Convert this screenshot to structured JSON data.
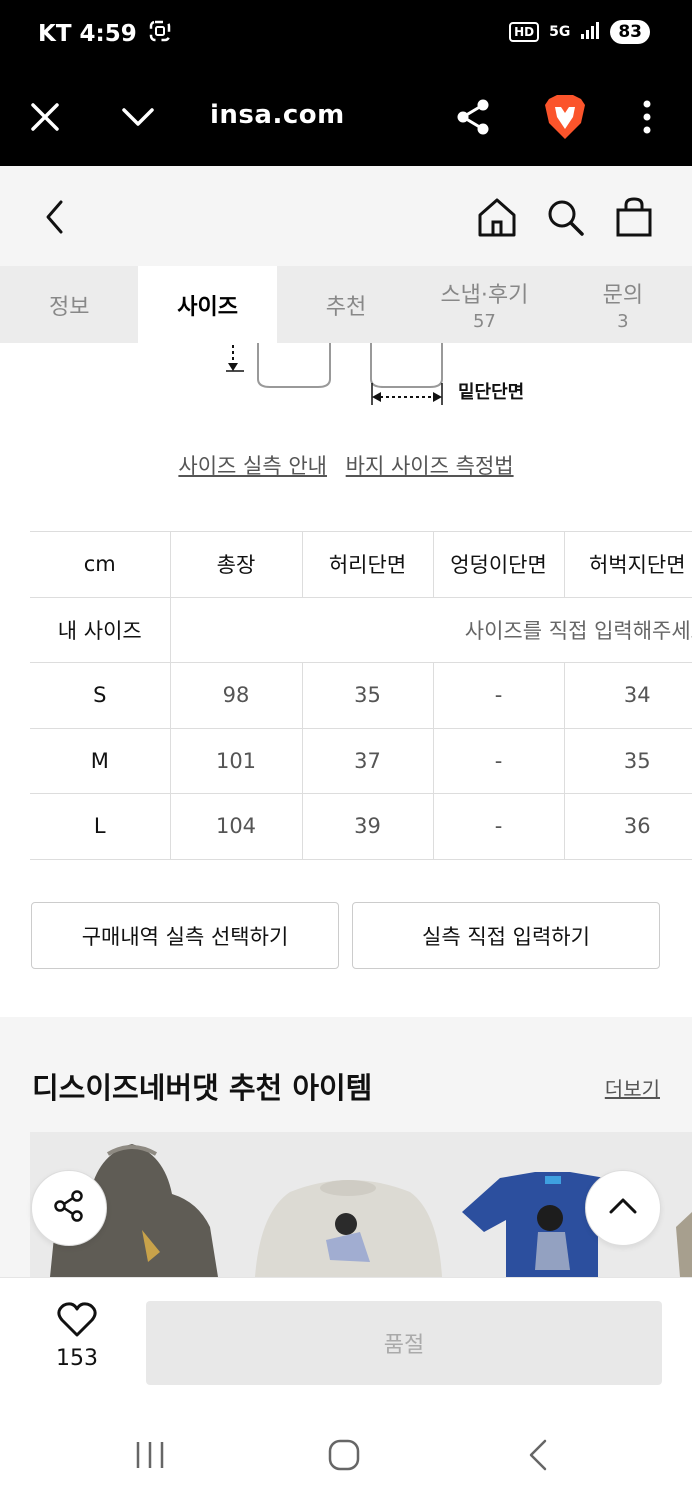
{
  "status_bar": {
    "carrier_time": "KT 4:59",
    "hd": "HD",
    "network": "5G",
    "battery": "83"
  },
  "browser": {
    "url": "insa.com",
    "icons": [
      "close-icon",
      "chevron-down-icon",
      "share-icon",
      "brave-lion-icon",
      "more-vertical-icon"
    ],
    "brand_color": "#fb542b"
  },
  "header": {
    "icons": [
      "back-icon",
      "home-icon",
      "search-icon",
      "shopping-bag-icon"
    ]
  },
  "tabs": [
    {
      "label": "정보",
      "count": ""
    },
    {
      "label": "사이즈",
      "count": ""
    },
    {
      "label": "추천",
      "count": ""
    },
    {
      "label": "스냅·후기",
      "count": "57"
    },
    {
      "label": "문의",
      "count": "3"
    }
  ],
  "diagram": {
    "label": "밑단단면"
  },
  "links": {
    "guide": "사이즈 실측 안내",
    "measure": "바지 사이즈 측정법"
  },
  "size_table": {
    "headers": [
      "cm",
      "총장",
      "허리단면",
      "엉덩이단면",
      "허벅지단면"
    ],
    "my_size": {
      "label": "내 사이즈",
      "placeholder": "사이즈를 직접 입력해주세요"
    },
    "rows": [
      {
        "size": "S",
        "values": [
          "98",
          "35",
          "-",
          "34"
        ]
      },
      {
        "size": "M",
        "values": [
          "101",
          "37",
          "-",
          "35"
        ]
      },
      {
        "size": "L",
        "values": [
          "104",
          "39",
          "-",
          "36"
        ]
      }
    ]
  },
  "buttons": {
    "purchase_history": "구매내역 실측 선택하기",
    "direct_input": "실측 직접 입력하기"
  },
  "recommend": {
    "title": "디스이즈네버댓 추천 아이템",
    "more": "더보기"
  },
  "buy_bar": {
    "like_count": "153",
    "soldout": "품절"
  },
  "nav": {
    "icons": [
      "recent-apps-icon",
      "home-circle-icon",
      "back-nav-icon"
    ]
  }
}
